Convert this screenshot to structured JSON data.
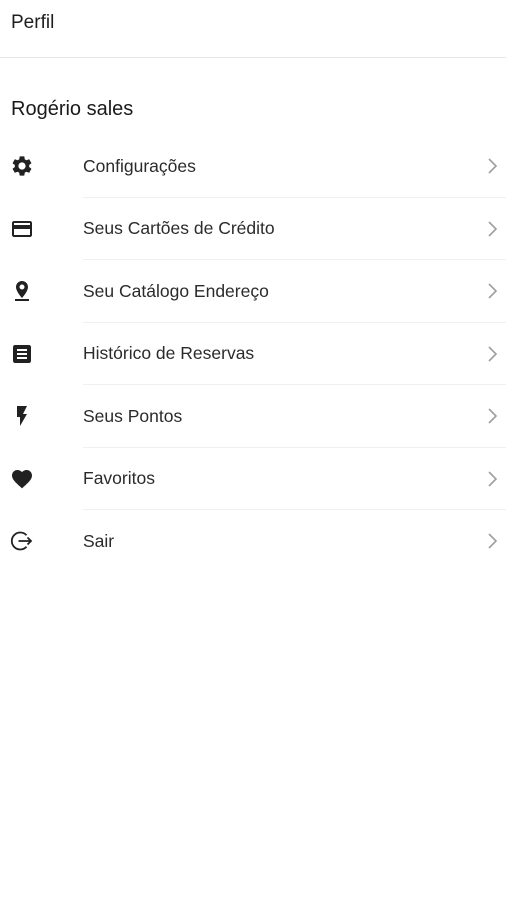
{
  "header": {
    "title": "Perfil"
  },
  "user": {
    "name": "Rogério sales"
  },
  "menu": [
    {
      "label": "Configurações",
      "icon": "gear-icon"
    },
    {
      "label": "Seus Cartões de Crédito",
      "icon": "credit-card-icon"
    },
    {
      "label": "Seu Catálogo Endereço",
      "icon": "location-pin-icon"
    },
    {
      "label": "Histórico de Reservas",
      "icon": "list-document-icon"
    },
    {
      "label": "Seus Pontos",
      "icon": "lightning-bolt-icon"
    },
    {
      "label": "Favoritos",
      "icon": "heart-icon"
    },
    {
      "label": "Sair",
      "icon": "logout-icon"
    }
  ]
}
